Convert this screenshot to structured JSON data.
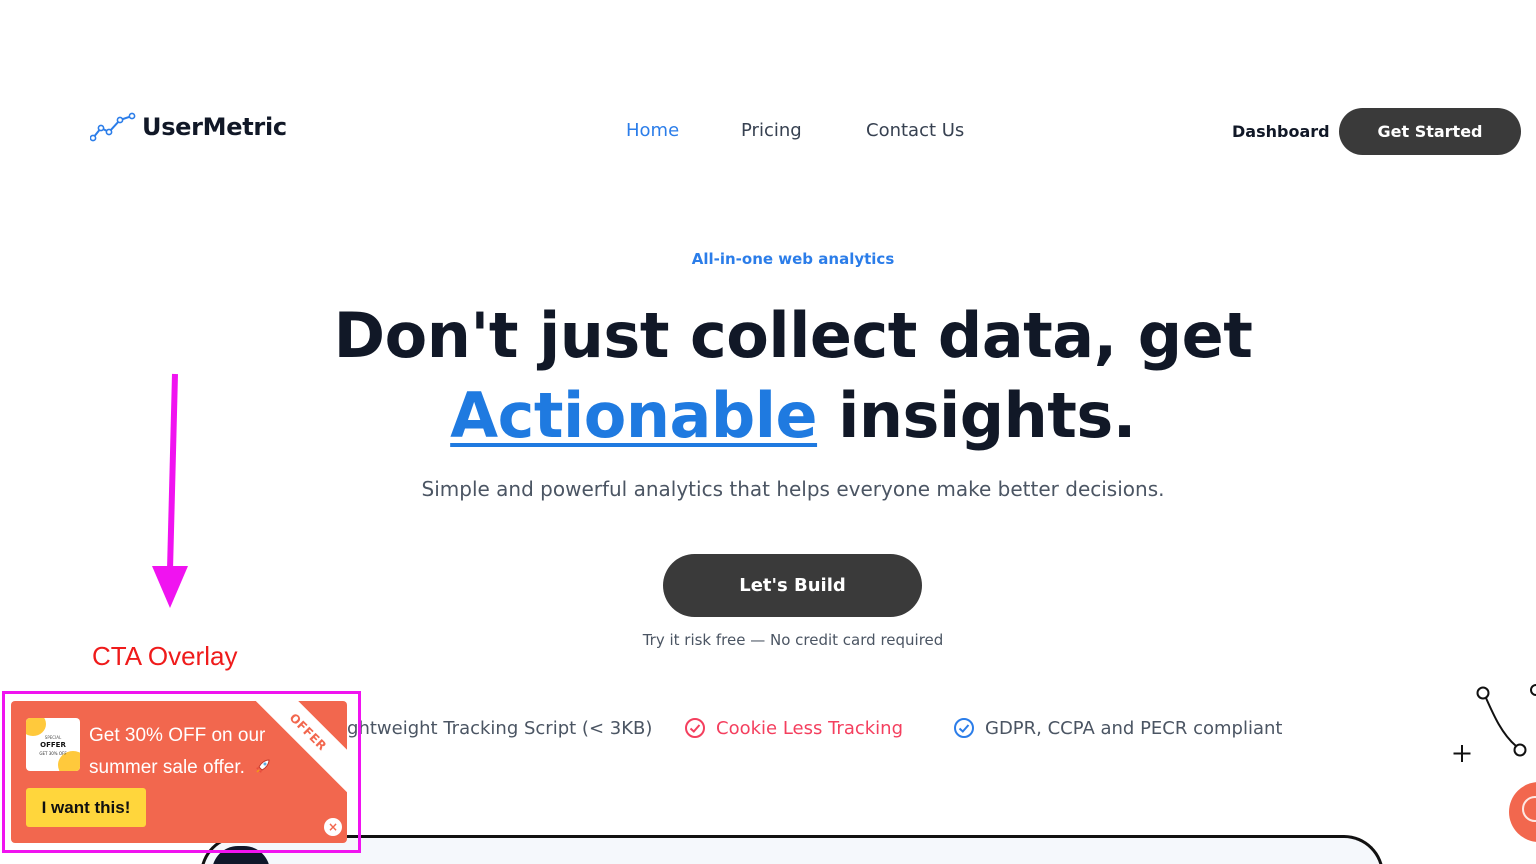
{
  "header": {
    "brand": "UserMetric",
    "nav": [
      {
        "label": "Home",
        "active": true
      },
      {
        "label": "Pricing",
        "active": false
      },
      {
        "label": "Contact Us",
        "active": false
      }
    ],
    "dashboard_label": "Dashboard",
    "get_started_label": "Get Started"
  },
  "hero": {
    "eyebrow": "All-in-one web analytics",
    "title_line1": "Don't just collect data, get",
    "title_accent": "Actionable",
    "title_rest": " insights.",
    "subtitle": "Simple and powerful analytics that helps everyone make better decisions.",
    "cta_label": "Let's Build",
    "risk_note": "Try it risk free — No credit card required"
  },
  "features": [
    {
      "label": "Lightweight Tracking Script (< 3KB)",
      "icon": "check-circle-icon",
      "color": "#2b7de9"
    },
    {
      "label": "Cookie Less Tracking",
      "icon": "check-circle-icon",
      "color": "#f43f5e"
    },
    {
      "label": "GDPR, CCPA and PECR compliant",
      "icon": "check-circle-icon",
      "color": "#2b7de9"
    }
  ],
  "annotation": {
    "label": "CTA Overlay",
    "color": "#f013f0",
    "label_color": "#ef1b1b"
  },
  "cta_overlay": {
    "thumb_small": "SPECIAL",
    "thumb_big": "OFFER",
    "thumb_sub": "GET 30% OFF",
    "message": "Get 30% OFF on our summer sale offer.",
    "button_label": "I want this!",
    "ribbon_label": "OFFER",
    "close_symbol": "×",
    "bg_color": "#f2674e",
    "button_color": "#ffd63c"
  },
  "colors": {
    "accent": "#2b7de9",
    "dark_button": "#3a3a3a",
    "heading": "#111827"
  }
}
